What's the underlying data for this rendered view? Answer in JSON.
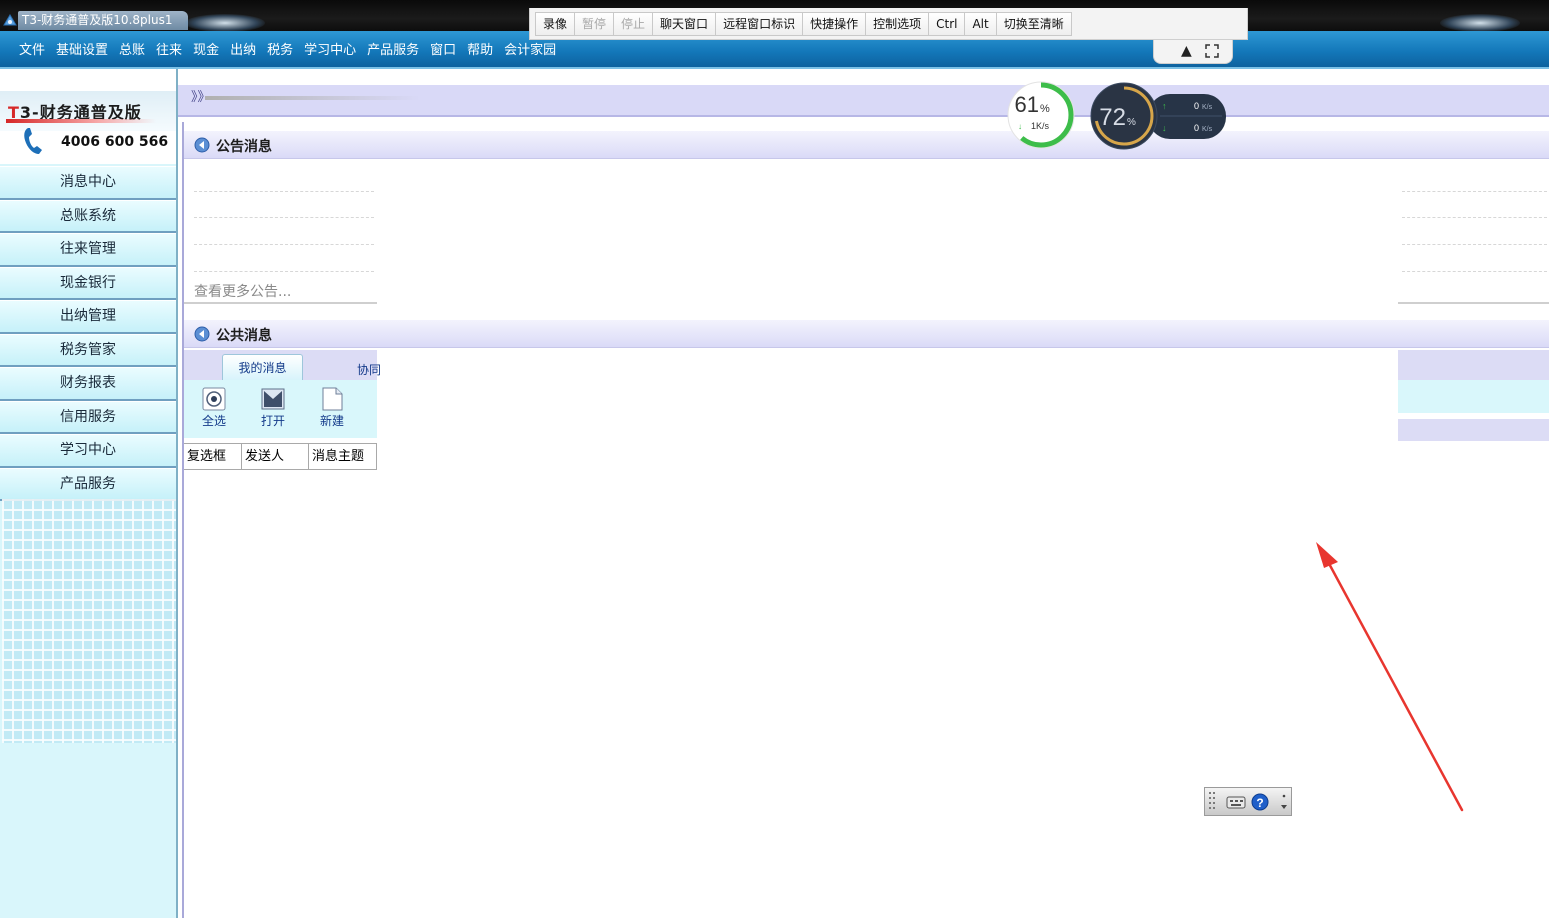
{
  "window": {
    "title": "T3-财务通普及版10.8plus1"
  },
  "menu": [
    "文件",
    "基础设置",
    "总账",
    "往来",
    "现金",
    "出纳",
    "税务",
    "学习中心",
    "产品服务",
    "窗口",
    "帮助",
    "会计家园"
  ],
  "remote_toolbar": {
    "buttons": [
      {
        "label": "录像",
        "enabled": true
      },
      {
        "label": "暂停",
        "enabled": false
      },
      {
        "label": "停止",
        "enabled": false
      },
      {
        "label": "聊天窗口",
        "enabled": true
      },
      {
        "label": "远程窗口标识",
        "enabled": true
      },
      {
        "label": "快捷操作",
        "enabled": true
      },
      {
        "label": "控制选项",
        "enabled": true
      },
      {
        "label": "Ctrl",
        "enabled": true
      },
      {
        "label": "Alt",
        "enabled": true
      },
      {
        "label": "切换至清晰",
        "enabled": true
      }
    ]
  },
  "sidebar": {
    "brand_prefix": "T",
    "brand_rest": "3-财务通普及版",
    "phone": "4006 600 566",
    "items": [
      "消息中心",
      "总账系统",
      "往来管理",
      "现金银行",
      "出纳管理",
      "税务管家",
      "财务报表",
      "信用服务",
      "学习中心",
      "产品服务"
    ]
  },
  "breadcrumb": {
    "arrows": "》》"
  },
  "notice_panel": {
    "title": "公告消息",
    "more": "查看更多公告..."
  },
  "public_panel": {
    "title": "公共消息",
    "tabs": [
      "我的消息",
      "协同"
    ],
    "tools": [
      "全选",
      "打开",
      "新建"
    ],
    "columns": [
      "复选框",
      "发送人",
      "消息主题"
    ]
  },
  "monitor": {
    "cpu_percent": 61,
    "cpu_unit": "%",
    "net_speed": "1K/s",
    "mem_percent": 72,
    "mem_unit": "%",
    "up_speed": "0",
    "down_speed": "0",
    "speed_unit": "K/s"
  },
  "colors": {
    "menubar": "#1377b9",
    "sidebar_bg": "#d9f6fb",
    "panel_header": "#dadaf7",
    "annotation_arrow": "#e8362f",
    "cpu_ring": "#3dbd4a"
  }
}
